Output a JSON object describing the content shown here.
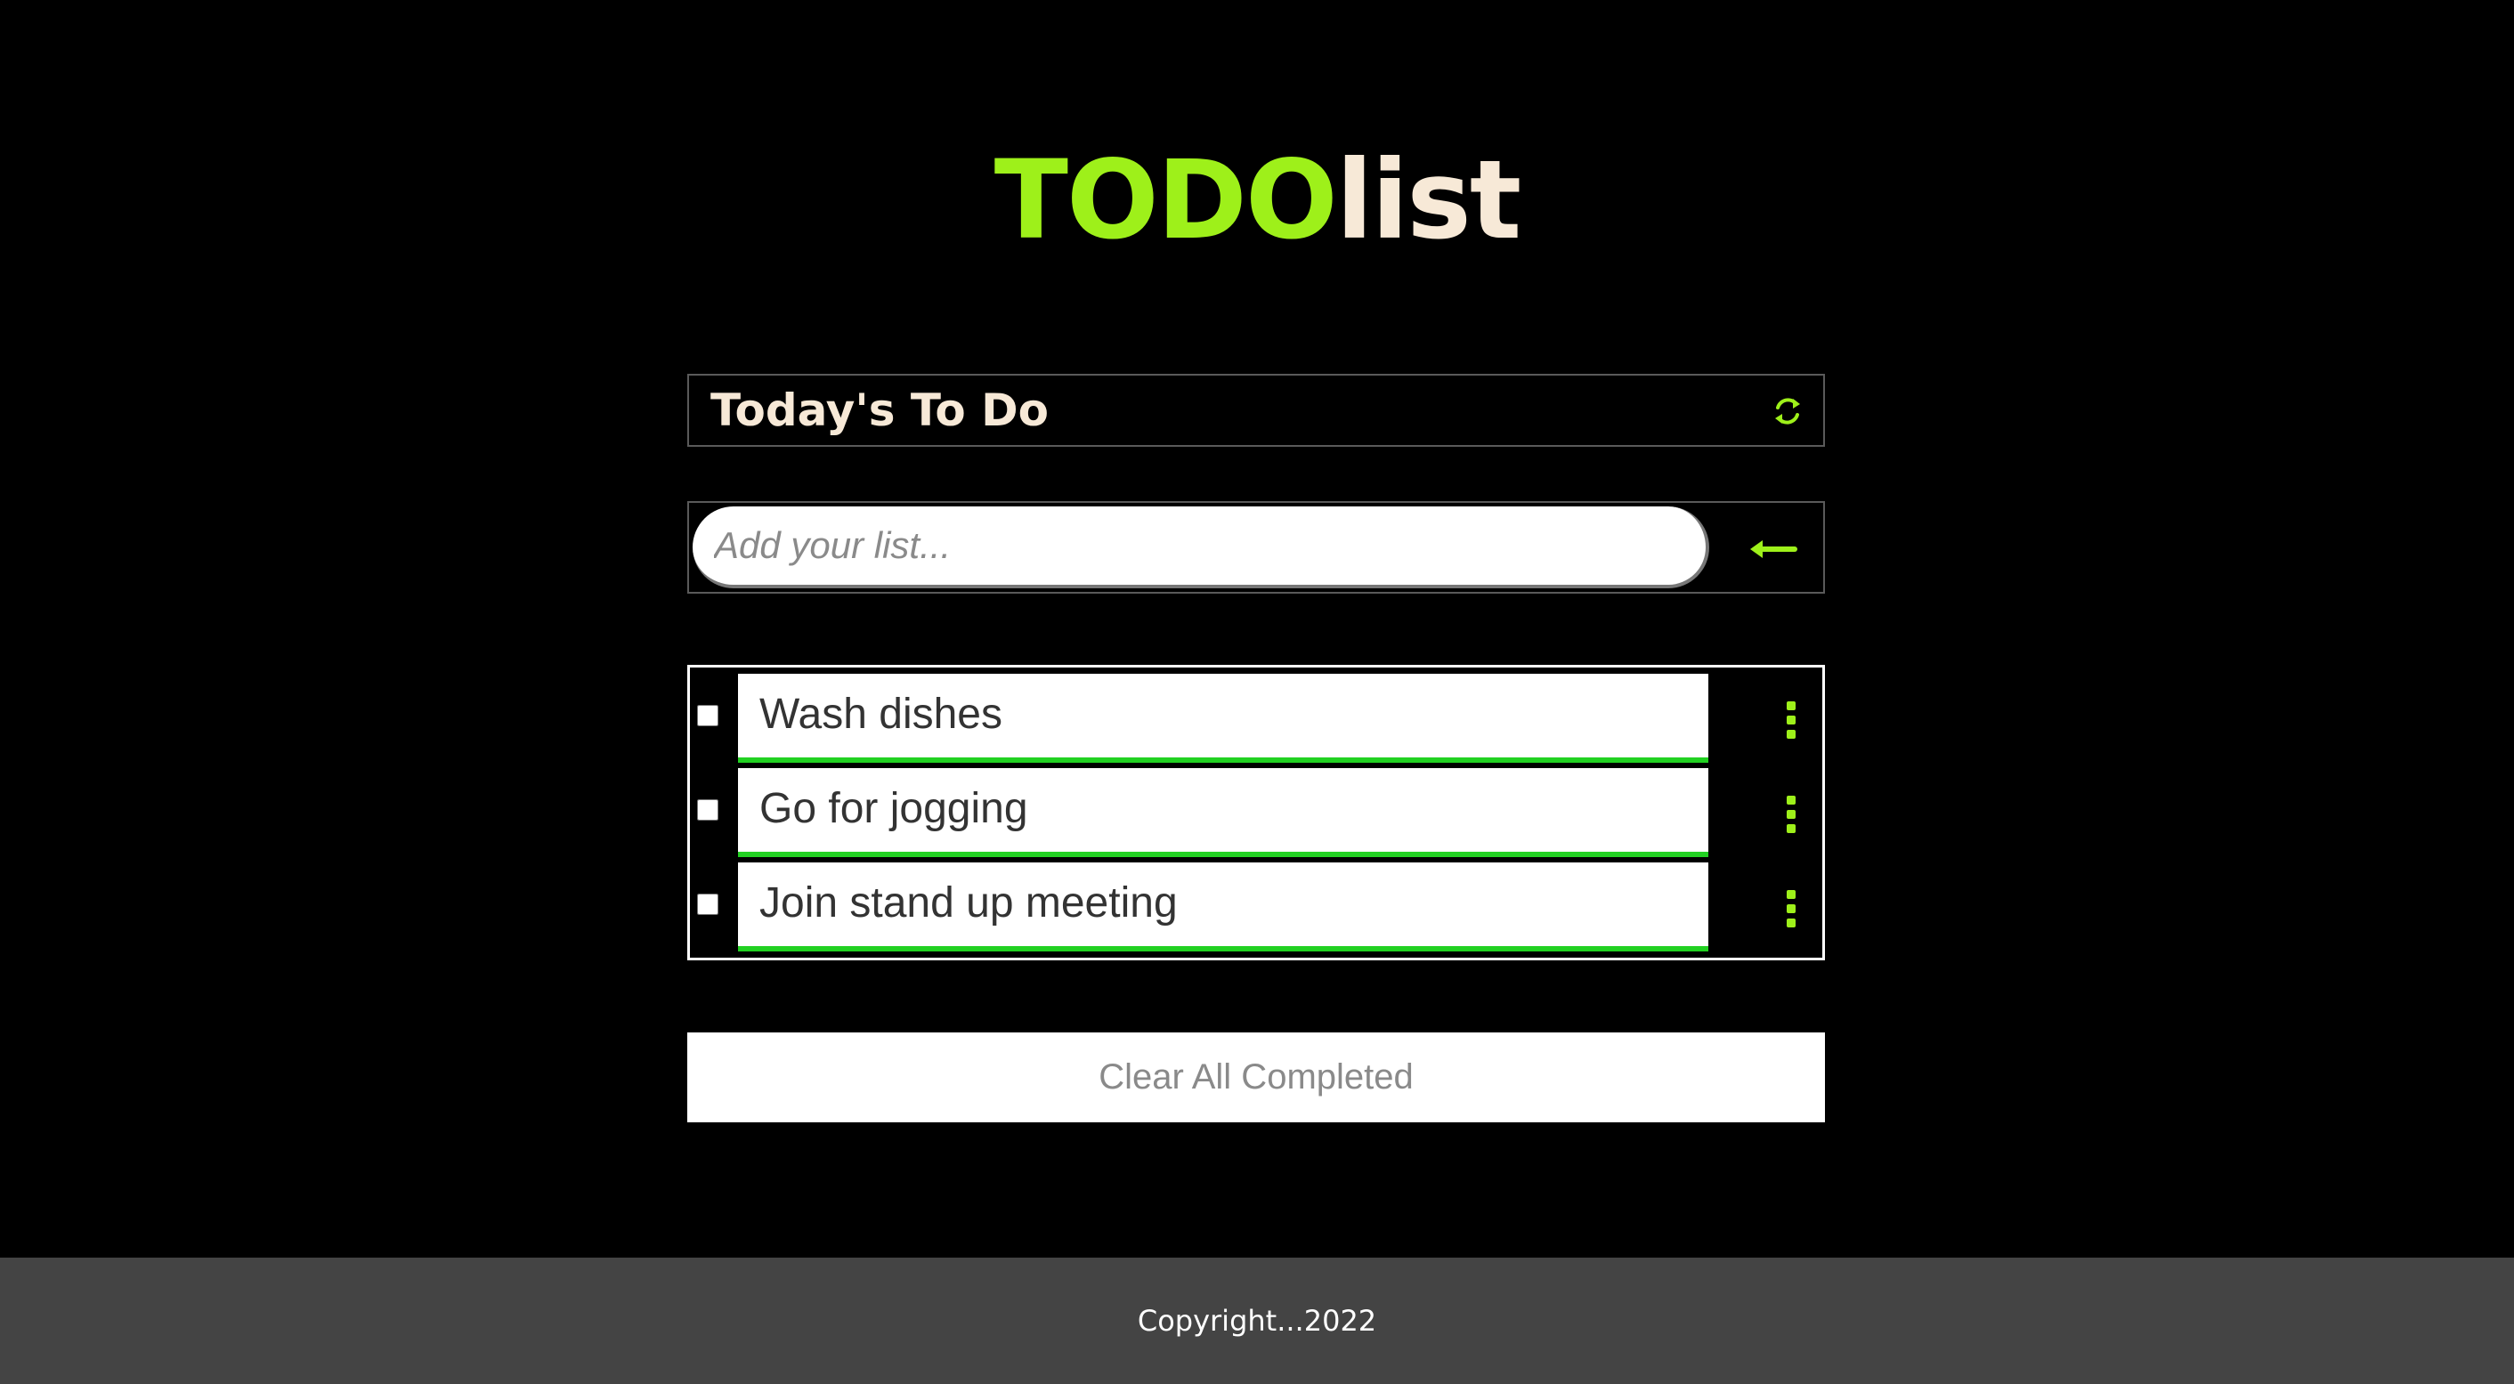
{
  "app": {
    "title_accent": "TODO",
    "title_rest": "list"
  },
  "header": {
    "date_title": "Today's To Do",
    "refresh_icon": "refresh-icon"
  },
  "input": {
    "placeholder": "Add your list...",
    "value": "",
    "add_icon": "arrow-left-icon"
  },
  "todos": [
    {
      "text": "Wash dishes",
      "checked": false
    },
    {
      "text": "Go for jogging",
      "checked": false
    },
    {
      "text": "Join stand up meeting",
      "checked": false
    }
  ],
  "actions": {
    "clear_label": "Clear All Completed"
  },
  "footer": {
    "copyright": "Copyright...2022"
  },
  "colors": {
    "accent": "#9ef01a",
    "title_rest": "#f7e9d7",
    "item_underline": "#22d122",
    "footer_bg": "#444444",
    "background": "#000000"
  }
}
